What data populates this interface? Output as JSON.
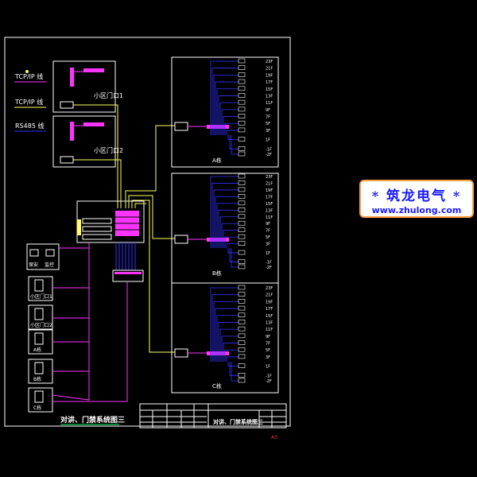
{
  "diagram": {
    "network_labels": [
      "TCP/IP 线",
      "TCP/IP 线",
      "RS485 线"
    ],
    "unit_labels": [
      "小区门口1",
      "小区门口2"
    ],
    "building_labels": [
      "A栋",
      "B栋",
      "C栋"
    ],
    "left_devices": [
      "保安",
      "监控",
      "小区门口1",
      "小区门口2",
      "A栋",
      "B栋",
      "C栋"
    ],
    "floors": [
      "23F",
      "21F",
      "19F",
      "17F",
      "15F",
      "13F",
      "11F",
      "9F",
      "7F",
      "5F",
      "3F",
      "1F",
      "-1F",
      "-2F"
    ],
    "caption": "对讲、门禁系统图三",
    "title_block_title": "对讲、门禁系统图三",
    "page_marker": "A3"
  },
  "watermark": {
    "brand": "筑龙电气",
    "star": "*",
    "url": "www.zhulong.com"
  },
  "colors": {
    "background": "#000000",
    "frame": "#ffffff",
    "magenta": "#ff33ff",
    "yellow": "#ffff66",
    "blue": "#3333ff",
    "white": "#ffffff",
    "watermark_border": "#ffa040",
    "watermark_text": "#1a1aff"
  }
}
